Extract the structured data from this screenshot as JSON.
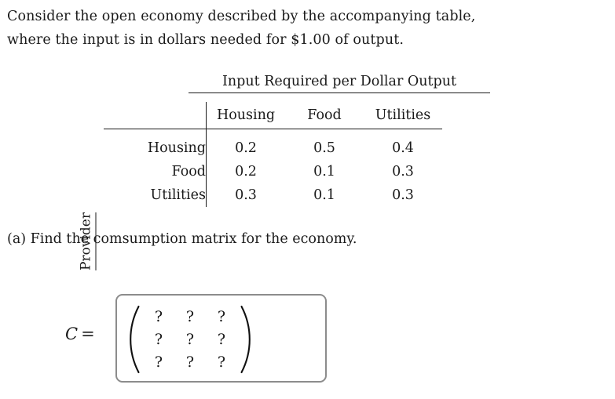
{
  "problem": {
    "line1": "Consider the open economy described by the accompanying table,",
    "line2": "where the input is in dollars needed for $1.00 of output."
  },
  "table": {
    "title": "Input Required per Dollar Output",
    "side_caption": "Provider",
    "column_headers": [
      "Housing",
      "Food",
      "Utilities"
    ],
    "row_headers": [
      "Housing",
      "Food",
      "Utilities"
    ],
    "rows": [
      {
        "label": "Housing",
        "values": [
          "0.2",
          "0.5",
          "0.4"
        ]
      },
      {
        "label": "Food",
        "values": [
          "0.2",
          "0.1",
          "0.3"
        ]
      },
      {
        "label": "Utilities",
        "values": [
          "0.3",
          "0.1",
          "0.3"
        ]
      }
    ]
  },
  "part_a": {
    "text": "(a) Find the comsumption matrix for the economy."
  },
  "answer": {
    "variable": "C",
    "equals": "=",
    "matrix": [
      [
        "?",
        "?",
        "?"
      ],
      [
        "?",
        "?",
        "?"
      ],
      [
        "?",
        "?",
        "?"
      ]
    ],
    "box_border_color": "#8c8c8c"
  },
  "chart_data": {
    "type": "table",
    "title": "Input Required per Dollar Output",
    "xlabel": "",
    "ylabel": "Provider",
    "categories": [
      "Housing",
      "Food",
      "Utilities"
    ],
    "series": [
      {
        "name": "Housing",
        "values": [
          0.2,
          0.5,
          0.4
        ]
      },
      {
        "name": "Food",
        "values": [
          0.2,
          0.1,
          0.3
        ]
      },
      {
        "name": "Utilities",
        "values": [
          0.3,
          0.1,
          0.3
        ]
      }
    ]
  }
}
